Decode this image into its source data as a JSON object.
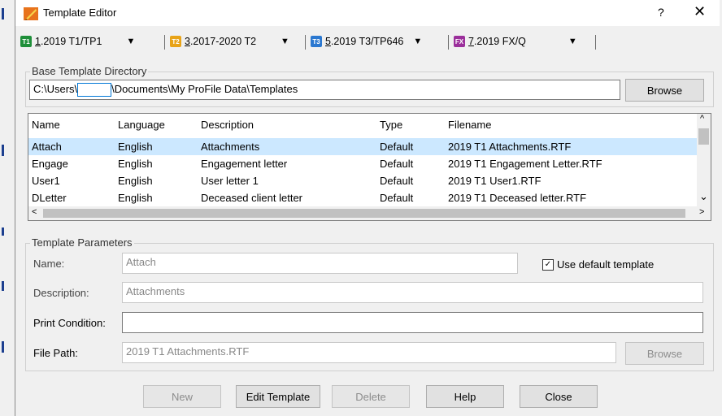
{
  "window": {
    "title": "Template Editor",
    "help_glyph": "?",
    "close_glyph": "✕"
  },
  "tabs": [
    {
      "icon_text": "T1",
      "icon_color": "#1f8f3a",
      "mnemonic": "1",
      "label": ".2019 T1/TP1",
      "arrow": "▼"
    },
    {
      "icon_text": "T2",
      "icon_color": "#e8a317",
      "mnemonic": "3",
      "label": ".2017-2020 T2",
      "arrow": "▼"
    },
    {
      "icon_text": "T3",
      "icon_color": "#2b78d0",
      "mnemonic": "5",
      "label": ".2019 T3/TP646",
      "arrow": "▼"
    },
    {
      "icon_text": "FX",
      "icon_color": "#9b2f9b",
      "mnemonic": "7",
      "label": ".2019 FX/Q",
      "arrow": "▼"
    }
  ],
  "base_dir": {
    "group_label": "Base Template Directory",
    "path_prefix": "C:\\Users\\",
    "path_suffix": "\\Documents\\My ProFile Data\\Templates",
    "browse_label": "Browse"
  },
  "list": {
    "columns": [
      "Name",
      "Language",
      "Description",
      "Type",
      "Filename"
    ],
    "rows": [
      [
        "Attach",
        "English",
        "Attachments",
        "Default",
        "2019 T1 Attachments.RTF"
      ],
      [
        "Engage",
        "English",
        "Engagement letter",
        "Default",
        "2019 T1 Engagement Letter.RTF"
      ],
      [
        "User1",
        "English",
        "User letter 1",
        "Default",
        "2019 T1 User1.RTF"
      ],
      [
        "DLetter",
        "English",
        "Deceased client letter",
        "Default",
        "2019 T1 Deceased letter.RTF"
      ]
    ],
    "selected_index": 0,
    "scroll_up": "^",
    "scroll_down": "⌄",
    "scroll_left": "<",
    "scroll_right": ">"
  },
  "params": {
    "group_label": "Template Parameters",
    "name_label": "Name:",
    "name_value": "Attach",
    "use_default_label": "Use default template",
    "use_default_checked": true,
    "description_label": "Description:",
    "description_value": "Attachments",
    "print_condition_label": "Print Condition:",
    "print_condition_value": "",
    "file_path_label": "File Path:",
    "file_path_value": "2019 T1 Attachments.RTF",
    "browse_label": "Browse"
  },
  "buttons": {
    "new": "New",
    "edit": "Edit Template",
    "delete": "Delete",
    "help": "Help",
    "close": "Close"
  },
  "colors": {
    "selected_row": "#cce8ff",
    "accent": "#0078d7"
  }
}
